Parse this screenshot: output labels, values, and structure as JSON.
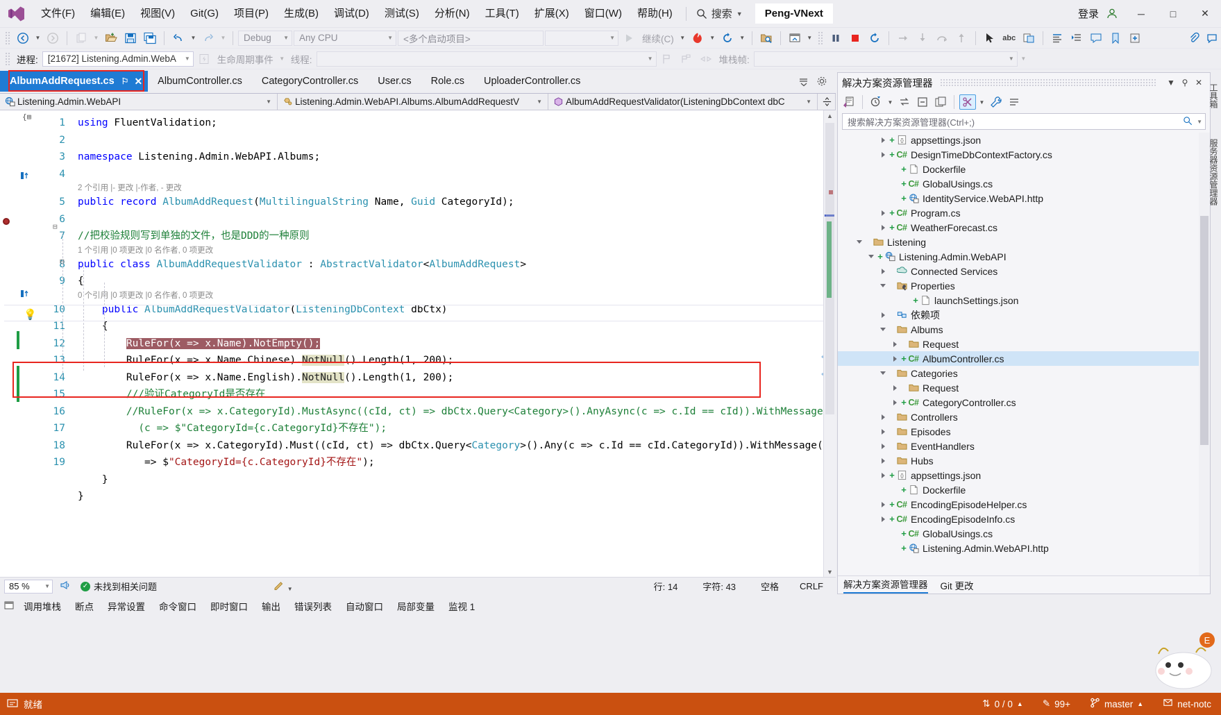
{
  "titlebar": {
    "logo_icon": "visual-studio-logo",
    "menus": [
      {
        "label": "文件(F)"
      },
      {
        "label": "编辑(E)"
      },
      {
        "label": "视图(V)"
      },
      {
        "label": "Git(G)"
      },
      {
        "label": "项目(P)"
      },
      {
        "label": "生成(B)"
      },
      {
        "label": "调试(D)"
      },
      {
        "label": "测试(S)"
      },
      {
        "label": "分析(N)"
      },
      {
        "label": "工具(T)"
      },
      {
        "label": "扩展(X)"
      },
      {
        "label": "窗口(W)"
      },
      {
        "label": "帮助(H)"
      }
    ],
    "search_label": "搜索",
    "project_name": "Peng-VNext",
    "signin_label": "登录",
    "minimize": "─",
    "maximize": "□",
    "close": "✕"
  },
  "toolbar1": {
    "nav_back_icon": "navigate-back-icon",
    "nav_forward_icon": "navigate-forward-icon",
    "new_item_icon": "new-item-icon",
    "open_file_icon": "open-file-icon",
    "save_icon": "save-icon",
    "save_all_icon": "save-all-icon",
    "undo_icon": "undo-icon",
    "redo_icon": "redo-icon",
    "config_combo": "Debug",
    "platform_combo": "Any CPU",
    "startup_combo": "<多个启动项目>",
    "empty_combo": "",
    "continue_label": "继续(C)",
    "hot_reload_icon": "hot-reload-icon",
    "restart_icon": "restart-icon",
    "attach_icon": "attach-to-process-icon",
    "window_icon": "window-layout-icon",
    "pause_icon": "pause-icon",
    "stop_icon": "stop-icon",
    "restart2_icon": "restart-debug-icon",
    "step_into_icon": "step-into-icon",
    "step_over_icon": "step-over-icon",
    "step_out_icon": "step-out-icon",
    "show_next_icon": "show-next-statement-icon",
    "abc_icon": "abc-icon",
    "cursor_icon": "pointer-icon",
    "live_icon": "live-share-icon",
    "align_icon": "align-icon",
    "indent_icon": "indent-icon",
    "comment_icon": "comment-icon",
    "bookmark_icon": "bookmark-icon",
    "expand_icon": "expand-icon",
    "attach2_icon": "attach-icon",
    "feedback_icon": "feedback-icon"
  },
  "toolbar2": {
    "process_label": "进程:",
    "process_value": "[21672] Listening.Admin.WebA",
    "lifecycle_label": "生命周期事件",
    "thread_label": "线程:",
    "thread_value": "",
    "stackframe_label": "堆栈帧:",
    "stackframe_value": "",
    "flag_icon": "flag-icon",
    "flags_icon": "flags-icon",
    "link_icon": "link-icon"
  },
  "tabs": {
    "items": [
      {
        "label": "AlbumAddRequest.cs",
        "active": true,
        "pin": "⚐",
        "close": "✕"
      },
      {
        "label": "AlbumController.cs",
        "active": false
      },
      {
        "label": "CategoryController.cs",
        "active": false
      },
      {
        "label": "User.cs",
        "active": false
      },
      {
        "label": "Role.cs",
        "active": false
      },
      {
        "label": "UploaderController.cs",
        "active": false
      }
    ],
    "menu_icon": "tab-list-icon",
    "settings_icon": "gear-icon",
    "highlight_color": "#e8251f"
  },
  "navbar": {
    "project": "Listening.Admin.WebAPI",
    "type": "Listening.Admin.WebAPI.Albums.AlbumAddRequestV",
    "member": "AlbumAddRequestValidator(ListeningDbContext dbC",
    "project_icon": "web-project-icon",
    "type_icon": "class-icon",
    "member_icon": "method-icon",
    "split_icon": "split-view-icon"
  },
  "editor": {
    "file": "AlbumAddRequest.cs",
    "lines": [
      {
        "num": "1",
        "codelens": null,
        "text": "using FluentValidation;"
      },
      {
        "num": "2",
        "codelens": null,
        "text": ""
      },
      {
        "num": "3",
        "codelens": null,
        "text": "namespace Listening.Admin.WebAPI.Albums;"
      },
      {
        "num": "4",
        "codelens": null,
        "text": ""
      },
      {
        "num": "5",
        "codelens": "2 个引用 |- 更改 |-作者, - 更改",
        "text": "public record AlbumAddRequest(MultilingualString Name, Guid CategoryId);"
      },
      {
        "num": "6",
        "codelens": null,
        "text": ""
      },
      {
        "num": "7",
        "codelens": null,
        "text": "//把校验规则写到单独的文件，也是DDD的一种原则"
      },
      {
        "num": "8",
        "codelens": "1 个引用 |0 项更改 |0 名作者, 0 项更改",
        "text": "public class AlbumAddRequestValidator : AbstractValidator<AlbumAddRequest>"
      },
      {
        "num": "9",
        "codelens": null,
        "text": "{"
      },
      {
        "num": "10",
        "codelens": "0 个引用 |0 项更改 |0 名作者, 0 项更改",
        "text": "    public AlbumAddRequestValidator(ListeningDbContext dbCtx)"
      },
      {
        "num": "11",
        "codelens": null,
        "text": "    {"
      },
      {
        "num": "12",
        "codelens": null,
        "text": "        RuleFor(x => x.Name).NotEmpty();"
      },
      {
        "num": "13",
        "codelens": null,
        "text": "        RuleFor(x => x.Name.Chinese).NotNull().Length(1, 200);"
      },
      {
        "num": "14",
        "codelens": null,
        "text": "        RuleFor(x => x.Name.English).NotNull().Length(1, 200);"
      },
      {
        "num": "15",
        "codelens": null,
        "text": "        ///验证CategoryId是否存在"
      },
      {
        "num": "16",
        "codelens": null,
        "text": "        //RuleFor(x => x.CategoryId).MustAsync((cId, ct) => dbCtx.Query<Category>().AnyAsync(c => c.Id == cId)).WithMessage"
      },
      {
        "num": "",
        "codelens": null,
        "text": "          (c => $\"CategoryId={c.CategoryId}不存在\");"
      },
      {
        "num": "17",
        "codelens": null,
        "text": "        RuleFor(x => x.CategoryId).Must((cId, ct) => dbCtx.Query<Category>().Any(c => c.Id == cId.CategoryId)).WithMessage(c"
      },
      {
        "num": "",
        "codelens": null,
        "text": "           => $\"CategoryId={c.CategoryId}不存在\");"
      },
      {
        "num": "18",
        "codelens": null,
        "text": "    }"
      },
      {
        "num": "19",
        "codelens": null,
        "text": "}"
      }
    ],
    "selected_text": "RuleFor(x => x.Name).NotEmpty();",
    "breakpoint_line": "12",
    "lightbulb_line": "14",
    "highlight_color": "#e8251f"
  },
  "editor_footer": {
    "zoom": "85 %",
    "megaphone_icon": "announcement-icon",
    "status_icon": "check-circle-icon",
    "status_text": "未找到相关问题",
    "pencil_icon": "edit-icon",
    "line_label": "行: 14",
    "col_label": "字符: 43",
    "spaces_label": "空格",
    "eol_label": "CRLF"
  },
  "dock_tabs": [
    {
      "label": "调用堆栈"
    },
    {
      "label": "断点"
    },
    {
      "label": "异常设置"
    },
    {
      "label": "命令窗口"
    },
    {
      "label": "即时窗口"
    },
    {
      "label": "输出"
    },
    {
      "label": "错误列表"
    },
    {
      "label": "自动窗口"
    },
    {
      "label": "局部变量"
    },
    {
      "label": "监视 1"
    }
  ],
  "solution_explorer": {
    "title": "解决方案资源管理器",
    "pin_icon": "pin-icon",
    "close_icon": "close-icon",
    "dropdown_icon": "chevron-down-icon",
    "toolbar": [
      {
        "name": "back-to-code-icon"
      },
      {
        "name": "pending-changes-icon"
      },
      {
        "name": "sync-with-active-icon"
      },
      {
        "name": "collapse-all-icon"
      },
      {
        "name": "show-all-files-icon"
      },
      {
        "name": "properties-icon"
      },
      {
        "name": "wrench-icon"
      },
      {
        "name": "view-icon"
      }
    ],
    "search_placeholder": "搜索解决方案资源管理器(Ctrl+;)",
    "search_icon": "search-icon",
    "tree": [
      {
        "indent": 3,
        "arrow": "closed",
        "plus": true,
        "icon": "json",
        "label": "appsettings.json",
        "selected": false
      },
      {
        "indent": 3,
        "arrow": "closed",
        "plus": true,
        "icon": "cs",
        "label": "DesignTimeDbContextFactory.cs",
        "selected": false
      },
      {
        "indent": 4,
        "arrow": "none",
        "plus": true,
        "icon": "file",
        "label": "Dockerfile",
        "selected": false
      },
      {
        "indent": 4,
        "arrow": "none",
        "plus": true,
        "icon": "cs",
        "label": "GlobalUsings.cs",
        "selected": false
      },
      {
        "indent": 4,
        "arrow": "none",
        "plus": true,
        "icon": "http",
        "label": "IdentityService.WebAPI.http",
        "selected": false
      },
      {
        "indent": 3,
        "arrow": "closed",
        "plus": true,
        "icon": "cs",
        "label": "Program.cs",
        "selected": false
      },
      {
        "indent": 3,
        "arrow": "closed",
        "plus": true,
        "icon": "cs",
        "label": "WeatherForecast.cs",
        "selected": false
      },
      {
        "indent": 1,
        "arrow": "open",
        "plus": false,
        "icon": "folder",
        "label": "Listening",
        "selected": false
      },
      {
        "indent": 2,
        "arrow": "open",
        "plus": true,
        "icon": "web",
        "label": "Listening.Admin.WebAPI",
        "selected": false
      },
      {
        "indent": 3,
        "arrow": "closed",
        "plus": false,
        "icon": "connected",
        "label": "Connected Services",
        "selected": false
      },
      {
        "indent": 3,
        "arrow": "open",
        "plus": false,
        "icon": "props",
        "label": "Properties",
        "selected": false
      },
      {
        "indent": 5,
        "arrow": "none",
        "plus": true,
        "icon": "file",
        "label": "launchSettings.json",
        "selected": false
      },
      {
        "indent": 3,
        "arrow": "closed",
        "plus": false,
        "icon": "deps",
        "label": "依赖项",
        "selected": false
      },
      {
        "indent": 3,
        "arrow": "open",
        "plus": false,
        "icon": "folder",
        "label": "Albums",
        "selected": false
      },
      {
        "indent": 4,
        "arrow": "closed",
        "plus": false,
        "icon": "folder",
        "label": "Request",
        "selected": false
      },
      {
        "indent": 4,
        "arrow": "closed",
        "plus": true,
        "icon": "cs",
        "label": "AlbumController.cs",
        "selected": true
      },
      {
        "indent": 3,
        "arrow": "open",
        "plus": false,
        "icon": "folder",
        "label": "Categories",
        "selected": false
      },
      {
        "indent": 4,
        "arrow": "closed",
        "plus": false,
        "icon": "folder",
        "label": "Request",
        "selected": false
      },
      {
        "indent": 4,
        "arrow": "closed",
        "plus": true,
        "icon": "cs",
        "label": "CategoryController.cs",
        "selected": false
      },
      {
        "indent": 3,
        "arrow": "closed",
        "plus": false,
        "icon": "folder",
        "label": "Controllers",
        "selected": false
      },
      {
        "indent": 3,
        "arrow": "closed",
        "plus": false,
        "icon": "folder",
        "label": "Episodes",
        "selected": false
      },
      {
        "indent": 3,
        "arrow": "closed",
        "plus": false,
        "icon": "folder",
        "label": "EventHandlers",
        "selected": false
      },
      {
        "indent": 3,
        "arrow": "closed",
        "plus": false,
        "icon": "folder",
        "label": "Hubs",
        "selected": false
      },
      {
        "indent": 3,
        "arrow": "closed",
        "plus": true,
        "icon": "json",
        "label": "appsettings.json",
        "selected": false
      },
      {
        "indent": 4,
        "arrow": "none",
        "plus": true,
        "icon": "file",
        "label": "Dockerfile",
        "selected": false
      },
      {
        "indent": 3,
        "arrow": "closed",
        "plus": true,
        "icon": "cs",
        "label": "EncodingEpisodeHelper.cs",
        "selected": false
      },
      {
        "indent": 3,
        "arrow": "closed",
        "plus": true,
        "icon": "cs",
        "label": "EncodingEpisodeInfo.cs",
        "selected": false
      },
      {
        "indent": 4,
        "arrow": "none",
        "plus": true,
        "icon": "cs",
        "label": "GlobalUsings.cs",
        "selected": false
      },
      {
        "indent": 4,
        "arrow": "none",
        "plus": true,
        "icon": "http",
        "label": "Listening.Admin.WebAPI.http",
        "selected": false
      }
    ],
    "footer_tabs": [
      {
        "label": "解决方案资源管理器",
        "active": true
      },
      {
        "label": "Git 更改",
        "active": false
      }
    ]
  },
  "statusbar": {
    "state": "就绪",
    "ready_icon": "ready-icon",
    "sync_label": "0 / 0",
    "sync_icon": "updown-arrows-icon",
    "up_caret": "▲",
    "edit_icon": "pencil-icon",
    "changes_label": "99+",
    "branch_icon": "branch-icon",
    "branch_label": "master",
    "branch_caret": "▲",
    "notify_icon": "bell-icon",
    "notify_label": "net-notc",
    "background": "#ca5010"
  }
}
